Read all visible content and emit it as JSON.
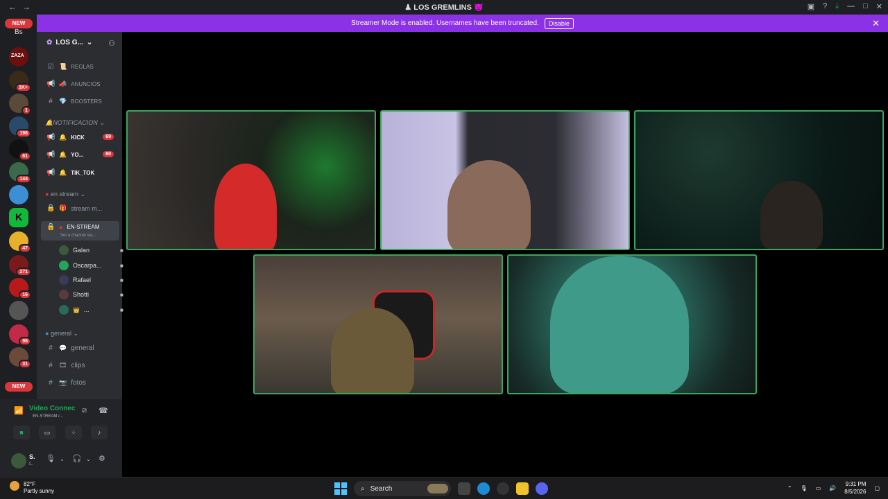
{
  "window": {
    "title": "LOS GREMLINS",
    "back": "←",
    "forward": "→"
  },
  "banner": {
    "text": "Streamer Mode is enabled. Usernames have been truncated.",
    "button": "Disable"
  },
  "guilds": {
    "new_top": "NEW",
    "new_bottom": "NEW",
    "top_label": "Bs",
    "badges": [
      "1K+",
      "1",
      "198",
      "61",
      "144",
      "47",
      "271",
      "16",
      "98",
      "31"
    ]
  },
  "server": {
    "name": "LOS G...",
    "chevron": "⌄"
  },
  "channels": {
    "reglas": "REGLAS",
    "anuncios": "ANUNCIOS",
    "boosters": "BOOSTERS",
    "cat_notificacion": "NOTIFICACION",
    "kick": "KICK",
    "kick_badge": "69",
    "yo": "YO...",
    "yo_badge": "60",
    "tiktok": "TIK_TOK",
    "cat_en_stream": "en stream",
    "stream_m": "stream m...",
    "en_stream": "EN-STREAM",
    "set_status": "Set a channel sta...",
    "cat_general": "general",
    "general": "general",
    "clips": "clips",
    "fotos": "fotos"
  },
  "voice_users": [
    "Galan",
    "Oscarpa...",
    "Rafael",
    "Shotti",
    "..."
  ],
  "voice": {
    "status": "Video Connec",
    "channel": "EN-STREAM /..."
  },
  "user_panel": {
    "name": "S.",
    "sub": "L."
  },
  "taskbar": {
    "temp": "82°F",
    "weather": "Partly sunny",
    "search": "Search",
    "time": "9:31 PM",
    "date": "8/5/2026"
  },
  "colors": {
    "accent": "#8c32e6",
    "speaking": "#3ba55d",
    "badge": "#da373c"
  }
}
